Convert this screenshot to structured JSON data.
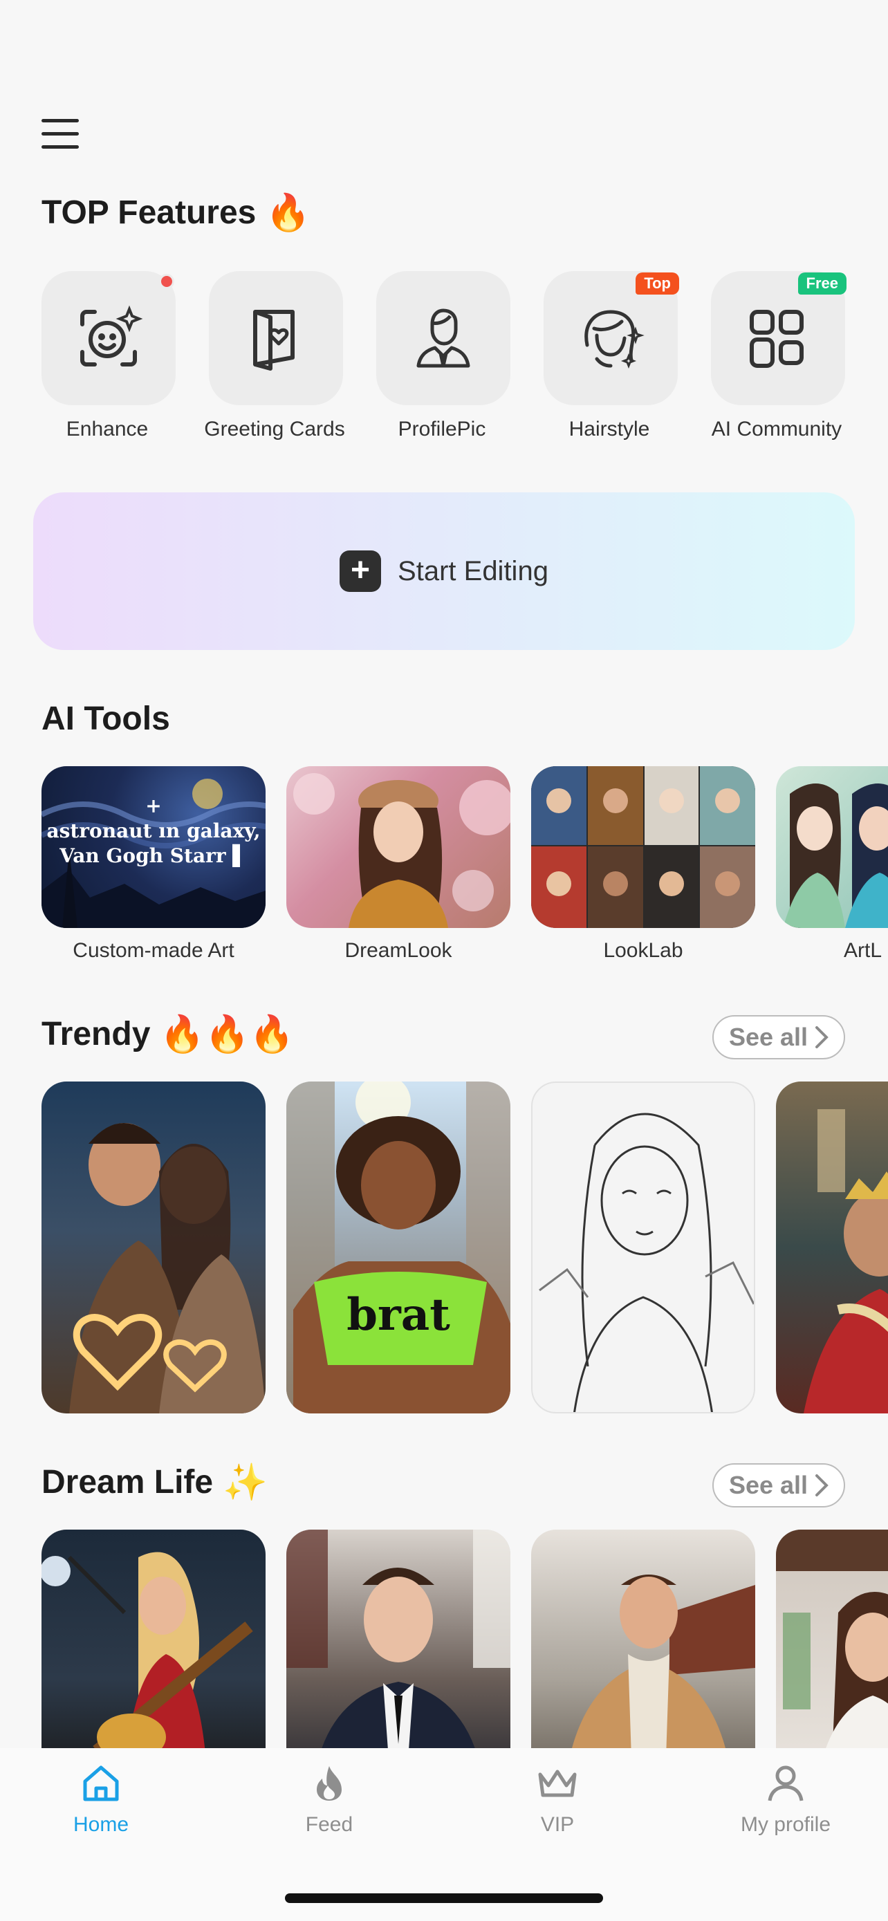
{
  "header": {
    "menu_icon": "hamburger-menu-icon"
  },
  "top_features": {
    "title": "TOP Features",
    "title_emoji": "🔥",
    "items": [
      {
        "label": "Enhance",
        "icon": "enhance-face-icon",
        "indicator": "red-dot"
      },
      {
        "label": "Greeting Cards",
        "icon": "greeting-card-icon"
      },
      {
        "label": "ProfilePic",
        "icon": "profile-person-icon"
      },
      {
        "label": "Hairstyle",
        "icon": "hairstyle-icon",
        "badge": "Top"
      },
      {
        "label": "AI Community",
        "icon": "grid-apps-icon",
        "badge": "Free"
      }
    ]
  },
  "start_editing": {
    "label": "Start Editing",
    "icon": "plus-icon"
  },
  "ai_tools": {
    "title": "AI Tools",
    "items": [
      {
        "label": "Custom-made Art",
        "overlay_plus": "+",
        "overlay_text_line1": "astronaut ın galaxy,",
        "overlay_text_line2": "Van Gogh Starr ▌"
      },
      {
        "label": "DreamLook"
      },
      {
        "label": "LookLab"
      },
      {
        "label": "ArtL"
      }
    ]
  },
  "trendy": {
    "title": "Trendy",
    "title_emoji": "🔥🔥🔥",
    "see_all": "See all",
    "items": [
      {
        "name": "sparkler-hearts-couple"
      },
      {
        "name": "brat-selfie",
        "shirt_text": "brat"
      },
      {
        "name": "sketch-portrait"
      },
      {
        "name": "royal-portrait"
      }
    ]
  },
  "dream_life": {
    "title": "Dream Life",
    "title_emoji": "✨",
    "see_all": "See all",
    "items": [
      {
        "name": "rock-guitarist"
      },
      {
        "name": "private-jet-businessman"
      },
      {
        "name": "train-station-traveler"
      },
      {
        "name": "cafe-woman"
      }
    ]
  },
  "bottom_nav": {
    "items": [
      {
        "label": "Home",
        "icon": "home-icon",
        "active": true
      },
      {
        "label": "Feed",
        "icon": "flame-icon"
      },
      {
        "label": "VIP",
        "icon": "crown-icon"
      },
      {
        "label": "My profile",
        "icon": "person-icon"
      }
    ]
  },
  "colors": {
    "accent": "#1aa0e6",
    "badge_top": "#f4511e",
    "badge_free": "#19c37d",
    "dot": "#f0514d"
  }
}
